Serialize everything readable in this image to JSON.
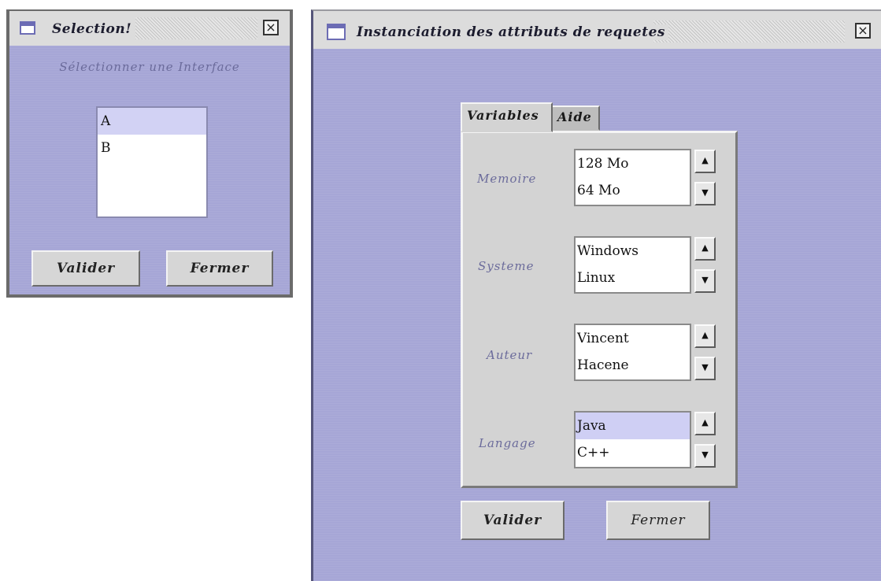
{
  "selection_dialog": {
    "title": "Selection!",
    "subtitle": "Sélectionner une Interface",
    "items": [
      {
        "label": "A",
        "selected": true
      },
      {
        "label": "B",
        "selected": false
      }
    ],
    "validate_label": "Valider",
    "close_label": "Fermer",
    "icons": {
      "window": "window-icon",
      "close": "close-icon"
    }
  },
  "instantiation_dialog": {
    "title": "Instanciation des attributs de requetes",
    "tabs": [
      {
        "label": "Variables",
        "active": true
      },
      {
        "label": "Aide",
        "active": false
      }
    ],
    "fields": [
      {
        "label": "Memoire",
        "options": [
          "128 Mo",
          "64 Mo"
        ],
        "selected_index": -1
      },
      {
        "label": "Systeme",
        "options": [
          "Windows",
          "Linux"
        ],
        "selected_index": -1
      },
      {
        "label": "Auteur",
        "options": [
          "Vincent",
          "Hacene"
        ],
        "selected_index": -1
      },
      {
        "label": "Langage",
        "options": [
          "Java",
          "C++"
        ],
        "selected_index": 0
      }
    ],
    "validate_label": "Valider",
    "close_label": "Fermer",
    "icons": {
      "window": "window-icon",
      "close": "close-icon",
      "up": "arrow-up-icon",
      "down": "arrow-down-icon"
    }
  },
  "colors": {
    "window_bg": "#a6a6d6",
    "titlebar": "#dcdcdc",
    "label_text": "#6b6b9b",
    "selection": "#d2d2f4",
    "panel": "#d3d3d3"
  }
}
